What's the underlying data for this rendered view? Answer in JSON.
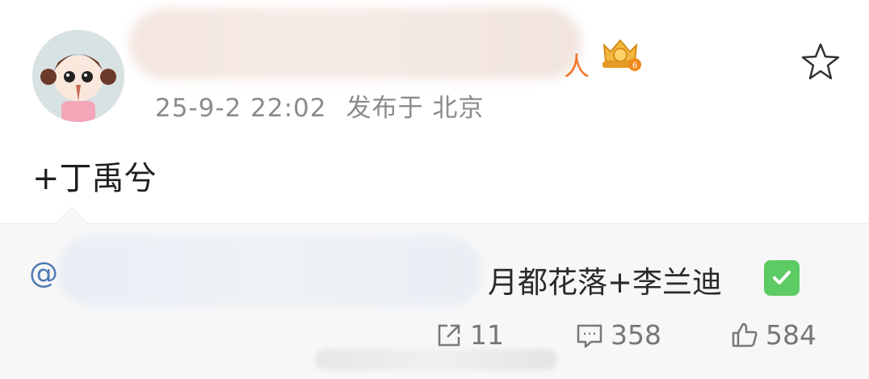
{
  "post": {
    "username_tail": "人",
    "timestamp": "25-9-2 22:02",
    "published_label": "发布于 北京",
    "text": "+丁禹兮"
  },
  "repost": {
    "at_symbol": "@",
    "text": "月都花落+李兰迪"
  },
  "stats": {
    "reposts": "11",
    "comments": "358",
    "likes": "584"
  },
  "icons": {
    "favorite": "star-icon",
    "badge": "crown-badge-icon",
    "verified": "checkmark-icon",
    "repost": "share-icon",
    "comment": "comment-icon",
    "like": "thumbs-up-icon"
  },
  "colors": {
    "accent": "#4f7bb3",
    "username": "#f2772a",
    "verified": "#5ccb63",
    "meta": "#8b8b8b"
  }
}
